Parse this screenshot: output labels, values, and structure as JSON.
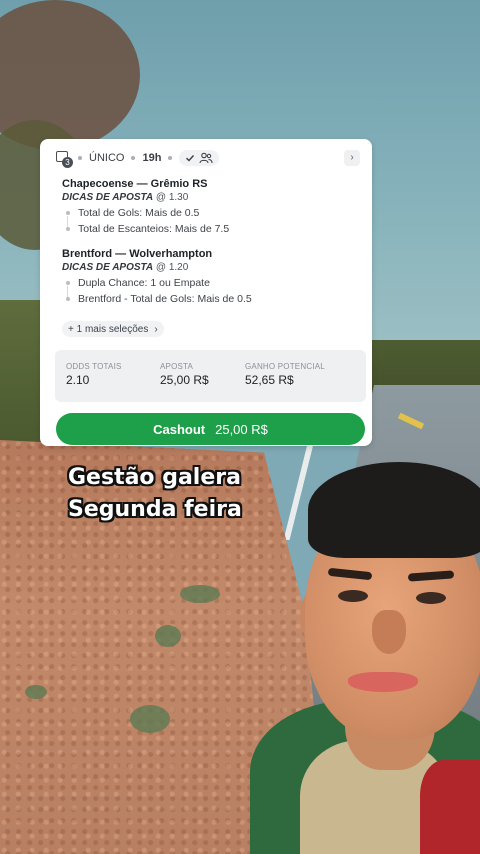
{
  "bet_card": {
    "header": {
      "ticket_count": "3",
      "bet_type": "ÚNICO",
      "time": "19h"
    },
    "matches": [
      {
        "title": "Chapecoense — Grêmio RS",
        "tips_label": "DICAS DE APOSTA",
        "odds": "@ 1.30",
        "selections": [
          "Total de Gols: Mais de 0.5",
          "Total de Escanteios: Mais de 7.5"
        ]
      },
      {
        "title": "Brentford — Wolverhampton",
        "tips_label": "DICAS DE APOSTA",
        "odds": "@ 1.20",
        "selections": [
          "Dupla Chance: 1 ou Empate",
          "Brentford - Total de Gols: Mais de 0.5"
        ]
      }
    ],
    "more_selections": "+ 1 mais seleções",
    "totals": {
      "odds_label": "ODDS TOTAIS",
      "odds_value": "2.10",
      "stake_label": "APOSTA",
      "stake_value": "25,00 R$",
      "potential_label": "GANHO POTENCIAL",
      "potential_value": "52,65 R$"
    },
    "cashout": {
      "label": "Cashout",
      "amount": "25,00 R$"
    }
  },
  "caption": {
    "line1": "Gestão galera",
    "line2": "Segunda feira"
  },
  "colors": {
    "cashout_green": "#1ea04a",
    "card_bg": "#ffffff",
    "totals_bg": "#eef0f2"
  },
  "icons": [
    "ticket-icon",
    "check-icon",
    "users-icon",
    "chevron-right-icon"
  ]
}
